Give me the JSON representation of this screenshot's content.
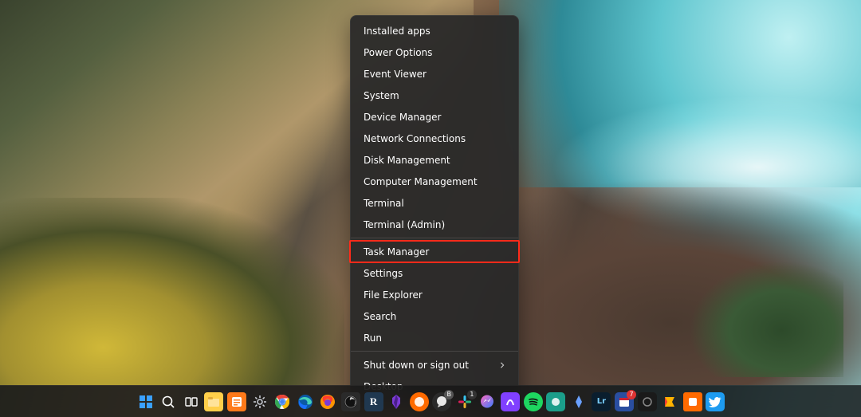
{
  "context_menu": {
    "items": [
      {
        "label": "Installed apps"
      },
      {
        "label": "Power Options"
      },
      {
        "label": "Event Viewer"
      },
      {
        "label": "System"
      },
      {
        "label": "Device Manager"
      },
      {
        "label": "Network Connections"
      },
      {
        "label": "Disk Management"
      },
      {
        "label": "Computer Management"
      },
      {
        "label": "Terminal"
      },
      {
        "label": "Terminal (Admin)"
      },
      {
        "label": "Task Manager",
        "highlighted": true
      },
      {
        "label": "Settings"
      },
      {
        "label": "File Explorer"
      },
      {
        "label": "Search"
      },
      {
        "label": "Run"
      },
      {
        "label": "Shut down or sign out",
        "submenu": true
      },
      {
        "label": "Desktop"
      }
    ],
    "separators_after": [
      9,
      14
    ]
  },
  "taskbar": {
    "icons": [
      {
        "name": "start",
        "title": "Start"
      },
      {
        "name": "search",
        "title": "Search"
      },
      {
        "name": "task-view",
        "title": "Task View"
      },
      {
        "name": "explorer",
        "title": "File Explorer"
      },
      {
        "name": "browser-orange",
        "title": "Browser"
      },
      {
        "name": "settings",
        "title": "Settings"
      },
      {
        "name": "chrome",
        "title": "Google Chrome"
      },
      {
        "name": "edge",
        "title": "Microsoft Edge"
      },
      {
        "name": "firefox",
        "title": "Firefox"
      },
      {
        "name": "obs",
        "title": "OBS Studio"
      },
      {
        "name": "app-r",
        "title": "App R"
      },
      {
        "name": "obsidian",
        "title": "Obsidian"
      },
      {
        "name": "notes-orange",
        "title": "Notes"
      },
      {
        "name": "app-bubble",
        "title": "Chat App"
      },
      {
        "name": "slack",
        "title": "Slack",
        "badge": "1",
        "badge_dark": true
      },
      {
        "name": "messenger",
        "title": "Messenger"
      },
      {
        "name": "app-purple",
        "title": "App"
      },
      {
        "name": "spotify",
        "title": "Spotify"
      },
      {
        "name": "app-teal",
        "title": "App"
      },
      {
        "name": "app-blue",
        "title": "App"
      },
      {
        "name": "lightroom",
        "title": "Adobe Lightroom"
      },
      {
        "name": "app-calendar",
        "title": "Calendar",
        "badge": "7"
      },
      {
        "name": "app-dark",
        "title": "App"
      },
      {
        "name": "app-gold",
        "title": "App"
      },
      {
        "name": "app-2",
        "title": "App"
      },
      {
        "name": "twitter",
        "title": "Twitter"
      }
    ]
  }
}
